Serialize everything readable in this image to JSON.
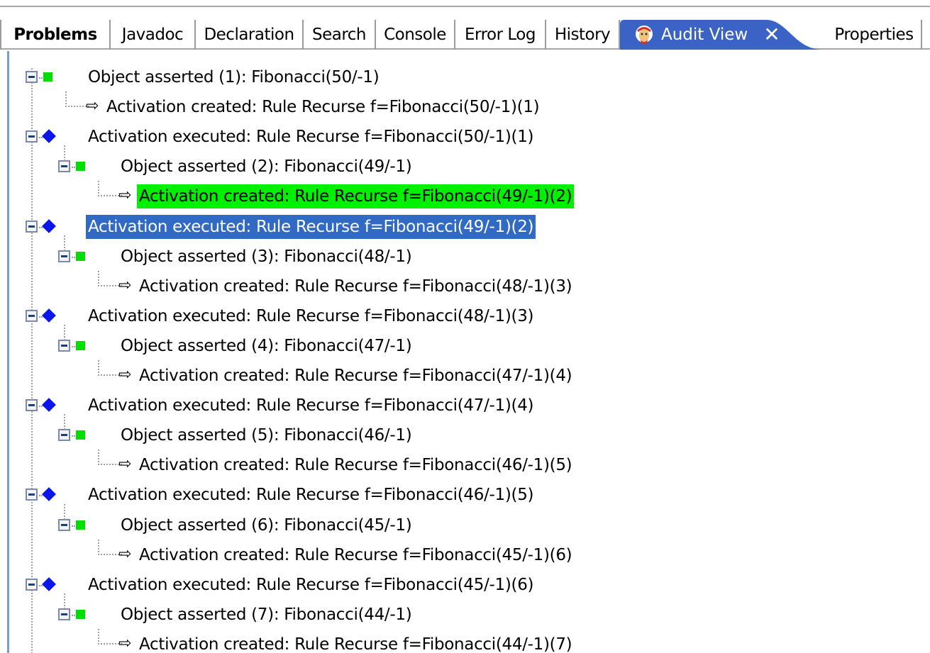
{
  "tabs": [
    {
      "id": "problems",
      "label": "Problems"
    },
    {
      "id": "javadoc",
      "label": "Javadoc"
    },
    {
      "id": "declaration",
      "label": "Declaration"
    },
    {
      "id": "search",
      "label": "Search"
    },
    {
      "id": "console",
      "label": "Console"
    },
    {
      "id": "errorlog",
      "label": "Error Log"
    },
    {
      "id": "history",
      "label": "History"
    }
  ],
  "active_tab": {
    "label": "Audit View",
    "icon": "audit-view-icon",
    "close_glyph": "✕"
  },
  "properties_tab": {
    "label": "Properties"
  },
  "colors": {
    "active_tab": "#3b63c5",
    "selection": "#316ac5",
    "highlight": "#00f000",
    "object_asserted_icon": "#00dd00",
    "activation_executed_icon": "#0a16ea"
  },
  "tree": [
    {
      "kind": "object-asserted",
      "level": 0,
      "text": "Object asserted (1): Fibonacci(50/-1)"
    },
    {
      "kind": "activation-created",
      "level": 1,
      "text": "Activation created: Rule Recurse f=Fibonacci(50/-1)(1)"
    },
    {
      "kind": "activation-executed",
      "level": 0,
      "text": "Activation executed: Rule Recurse f=Fibonacci(50/-1)(1)"
    },
    {
      "kind": "object-asserted",
      "level": 1,
      "text": "Object asserted (2): Fibonacci(49/-1)"
    },
    {
      "kind": "activation-created",
      "level": 2,
      "text": "Activation created: Rule Recurse f=Fibonacci(49/-1)(2)",
      "highlight": true
    },
    {
      "kind": "activation-executed",
      "level": 0,
      "text": "Activation executed: Rule Recurse f=Fibonacci(49/-1)(2)",
      "selected": true
    },
    {
      "kind": "object-asserted",
      "level": 1,
      "text": "Object asserted (3): Fibonacci(48/-1)"
    },
    {
      "kind": "activation-created",
      "level": 2,
      "text": "Activation created: Rule Recurse f=Fibonacci(48/-1)(3)"
    },
    {
      "kind": "activation-executed",
      "level": 0,
      "text": "Activation executed: Rule Recurse f=Fibonacci(48/-1)(3)"
    },
    {
      "kind": "object-asserted",
      "level": 1,
      "text": "Object asserted (4): Fibonacci(47/-1)"
    },
    {
      "kind": "activation-created",
      "level": 2,
      "text": "Activation created: Rule Recurse f=Fibonacci(47/-1)(4)"
    },
    {
      "kind": "activation-executed",
      "level": 0,
      "text": "Activation executed: Rule Recurse f=Fibonacci(47/-1)(4)"
    },
    {
      "kind": "object-asserted",
      "level": 1,
      "text": "Object asserted (5): Fibonacci(46/-1)"
    },
    {
      "kind": "activation-created",
      "level": 2,
      "text": "Activation created: Rule Recurse f=Fibonacci(46/-1)(5)"
    },
    {
      "kind": "activation-executed",
      "level": 0,
      "text": "Activation executed: Rule Recurse f=Fibonacci(46/-1)(5)"
    },
    {
      "kind": "object-asserted",
      "level": 1,
      "text": "Object asserted (6): Fibonacci(45/-1)"
    },
    {
      "kind": "activation-created",
      "level": 2,
      "text": "Activation created: Rule Recurse f=Fibonacci(45/-1)(6)"
    },
    {
      "kind": "activation-executed",
      "level": 0,
      "text": "Activation executed: Rule Recurse f=Fibonacci(45/-1)(6)"
    },
    {
      "kind": "object-asserted",
      "level": 1,
      "text": "Object asserted (7): Fibonacci(44/-1)"
    },
    {
      "kind": "activation-created",
      "level": 2,
      "text": "Activation created: Rule Recurse f=Fibonacci(44/-1)(7)"
    }
  ]
}
